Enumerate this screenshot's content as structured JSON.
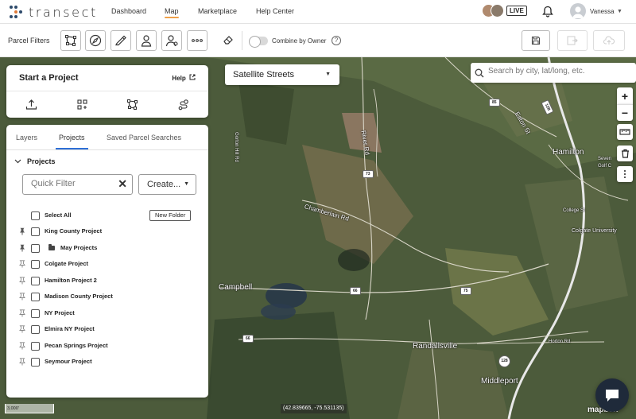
{
  "brand": {
    "name": "transect"
  },
  "nav": {
    "links": [
      "Dashboard",
      "Map",
      "Marketplace",
      "Help Center"
    ],
    "live_badge": "LIVE",
    "user_name": "Vanessa"
  },
  "toolbar": {
    "label": "Parcel Filters",
    "combine_label": "Combine by Owner",
    "help_glyph": "?",
    "filter_icons": [
      "polygon-draw-icon",
      "compass-icon",
      "ruler-pencil-icon",
      "owner-person-icon",
      "people-icon",
      "more-dots-icon"
    ]
  },
  "start_panel": {
    "title": "Start a Project",
    "help_label": "Help",
    "icons": [
      "upload-icon",
      "parcels-select-icon",
      "draw-shape-icon",
      "route-icon"
    ]
  },
  "projects_panel": {
    "tabs": [
      "Layers",
      "Projects",
      "Saved Parcel Searches"
    ],
    "active_tab": "Projects",
    "section_title": "Projects",
    "filter_placeholder": "Quick Filter",
    "create_label": "Create...",
    "select_all_label": "Select All",
    "new_folder_label": "New Folder",
    "items": [
      {
        "label": "King County Project",
        "pinned": true,
        "folder": false
      },
      {
        "label": "May Projects",
        "pinned": true,
        "folder": true
      },
      {
        "label": "Colgate Project",
        "pinned": false,
        "folder": false
      },
      {
        "label": "Hamilton Project 2",
        "pinned": false,
        "folder": false
      },
      {
        "label": "Madison County Project",
        "pinned": false,
        "folder": false
      },
      {
        "label": "NY Project",
        "pinned": false,
        "folder": false
      },
      {
        "label": "Elmira NY Project",
        "pinned": false,
        "folder": false
      },
      {
        "label": "Pecan Springs Project",
        "pinned": false,
        "folder": false
      },
      {
        "label": "Seymour Project",
        "pinned": false,
        "folder": false
      }
    ]
  },
  "map": {
    "style_select": "Satellite Streets",
    "search_placeholder": "Search by city, lat/long, etc.",
    "zoom_in": "+",
    "zoom_out": "−",
    "scale_label": "3,000'",
    "coordinates": "(42.839665, -75.531135)",
    "attribution": "mapbox",
    "labels": [
      "Hamilton",
      "Seven",
      "Golf C",
      "College St",
      "Colgate University",
      "Campbell",
      "Randallsville",
      "Middleport",
      "Chamberlain Rd",
      "River Rd",
      "Eaton St",
      "Horton Rd",
      "Gorton Hill Rd"
    ],
    "shields": [
      "85",
      "73",
      "66",
      "75",
      "128",
      "12B",
      "66"
    ]
  },
  "colors": {
    "accent": "#2d6fd6",
    "nav_underline": "#f0a14a",
    "chat_button": "#1f2a3a"
  }
}
